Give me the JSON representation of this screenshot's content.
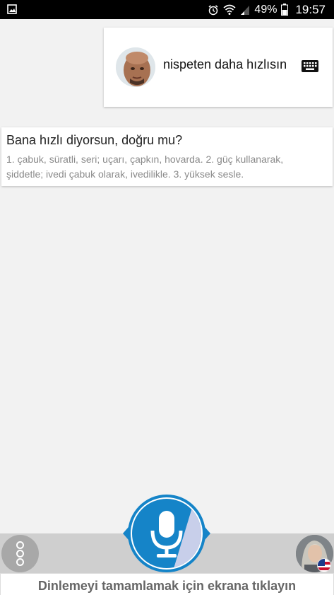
{
  "status_bar": {
    "battery_percent": "49%",
    "time": "19:57",
    "icons": [
      "image-icon",
      "alarm-icon",
      "wifi-icon",
      "signal-icon",
      "battery-icon"
    ]
  },
  "user_message": {
    "text": "nispeten daha hızlısın",
    "icons": [
      "user-avatar",
      "keyboard-icon"
    ]
  },
  "assistant_reply": {
    "title": "Bana hızlı diyorsun, doğru mu?",
    "definitions": "1. çabuk, süratli, seri; uçarı, çapkın, hovarda. 2. güç kullanarak, şiddetle; ivedi çabuk olarak, ivedilikle. 3. yüksek sesle."
  },
  "controls": {
    "icons": [
      "more-options-icon",
      "microphone-icon",
      "assistant-avatar",
      "flag-icon"
    ],
    "hint": "Dinlemeyi tamamlamak için ekrana tıklayın"
  },
  "colors": {
    "mic_blue": "#1584c8",
    "bottom_bar": "#cfcfcf",
    "background": "#f2f2f2"
  }
}
